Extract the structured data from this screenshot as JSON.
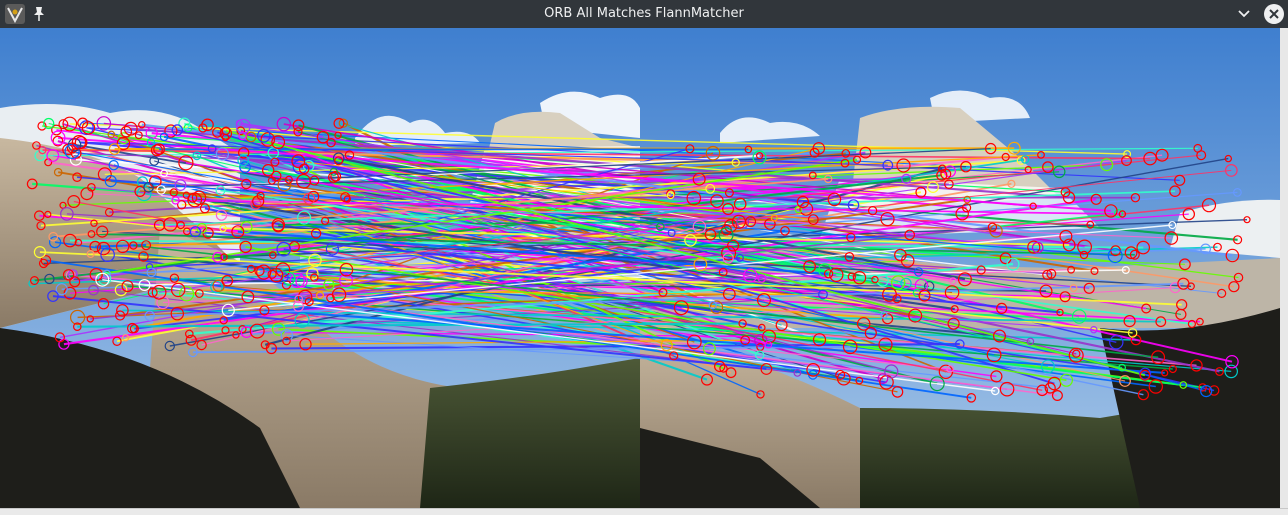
{
  "window": {
    "title": "ORB All Matches FlannMatcher",
    "icons": {
      "app": "app-icon",
      "pin": "pin-icon",
      "collapse": "chevron-down-icon",
      "close": "close-icon"
    }
  },
  "colors": {
    "titlebar": "#31363b",
    "sky_top": "#3f7fcf",
    "sky_bottom": "#a9c8e8",
    "keypoint_circle": "#ff0000"
  },
  "image": {
    "description_type": "feature-matches-visualization",
    "left_panel": "left-photo",
    "right_panel": "right-photo"
  }
}
